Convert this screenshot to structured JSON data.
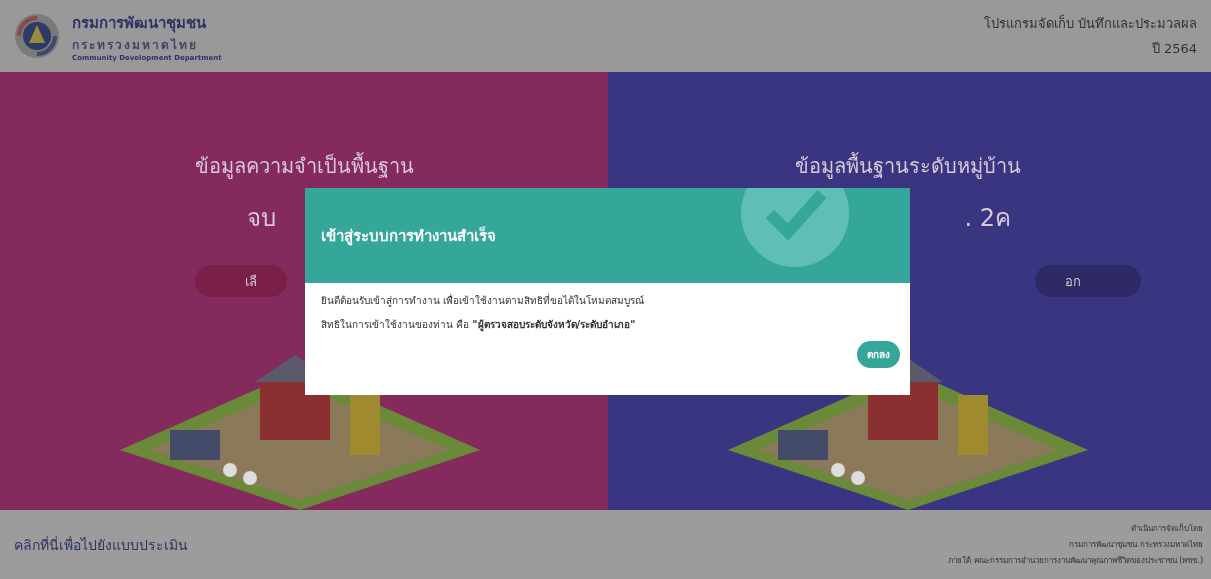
{
  "header": {
    "org_name": "กรมการพัฒนาชุมชน",
    "ministry": "กระทรวงมหาดไทย",
    "org_english": "Community Development Department",
    "program_title": "โปรแกรมจัดเก็บ บันทึกและประมวลผล",
    "year": "ปี 2564"
  },
  "panels": [
    {
      "kind": "left",
      "title": "ข้อมูลความจำเป็นพื้นฐาน",
      "subtitle": "จบ",
      "button": "เลื"
    },
    {
      "kind": "right",
      "title": "ข้อมูลพื้นฐานระดับหมู่บ้าน",
      "subtitle": ". 2ค",
      "button": "อก"
    }
  ],
  "dialog": {
    "title": "เข้าสู่ระบบการทำงานสำเร็จ",
    "message": "ยินดีต้อนรับเข้าสู่การทำงาน เพื่อเข้าใช้งานตามสิทธิที่ขอได้ในโหมดสมบูรณ์",
    "role_line": "สิทธิในการเข้าใช้งานของท่าน คือ **\"ผู้ตรวจสอบระดับจังหวัด/ระดับอำเภอ\"**",
    "ok_button": "ตกลง"
  },
  "footer": {
    "link": "คลิกที่นี่เพื่อไปยังแบบประเมิน",
    "credits": [
      "ดำเนินการจัดเก็บโดย",
      "กรมการพัฒนาชุมชน กระทรวงมหาดไทย",
      "ภายใต้ คณะกรรมการอำนวยการงานพัฒนาคุณภาพชีวิตของประชาชน (พชช.)"
    ]
  }
}
